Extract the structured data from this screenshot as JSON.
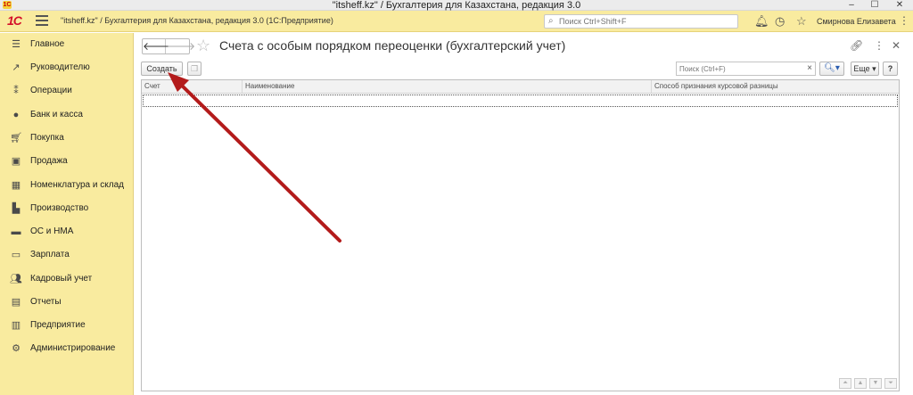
{
  "window": {
    "title": "\"itsheff.kz\" / Бухгалтерия для Казахстана, редакция 3.0",
    "minimize": "–",
    "maximize": "☐",
    "close": "✕"
  },
  "top_panel": {
    "logo": "1С",
    "caption": "\"itsheff.kz\" / Бухгалтерия для Казахстана, редакция 3.0  (1С:Предприятие)",
    "search_placeholder": "Поиск Ctrl+Shift+F",
    "user": "Смирнова Елизавета",
    "icons": [
      "bell-icon",
      "history-icon",
      "star-icon",
      "more-icon"
    ]
  },
  "sidebar": {
    "items": [
      {
        "label": "Главное",
        "icon": "menu-icon"
      },
      {
        "label": "Руководителю",
        "icon": "trend-icon"
      },
      {
        "label": "Операции",
        "icon": "operations-icon"
      },
      {
        "label": "Банк и касса",
        "icon": "bank-icon"
      },
      {
        "label": "Покупка",
        "icon": "cart-icon"
      },
      {
        "label": "Продажа",
        "icon": "bag-icon"
      },
      {
        "label": "Номенклатура и склад",
        "icon": "warehouse-icon"
      },
      {
        "label": "Производство",
        "icon": "factory-icon"
      },
      {
        "label": "ОС и НМА",
        "icon": "truck-icon"
      },
      {
        "label": "Зарплата",
        "icon": "salary-icon"
      },
      {
        "label": "Кадровый учет",
        "icon": "people-icon"
      },
      {
        "label": "Отчеты",
        "icon": "report-icon"
      },
      {
        "label": "Предприятие",
        "icon": "enterprise-icon"
      },
      {
        "label": "Администрирование",
        "icon": "gear-icon"
      }
    ]
  },
  "form": {
    "title": "Счета с особым порядком переоценки (бухгалтерский учет)",
    "back": "🡐",
    "forward": "🡒",
    "create_label": "Создать",
    "search_placeholder": "Поиск (Ctrl+F)",
    "more_label": "Еще ▾",
    "help_label": "?",
    "columns": [
      "Счет",
      "Наименование",
      "Способ признания курсовой разницы"
    ],
    "rows": []
  },
  "colors": {
    "panel": "#f9eb9f",
    "annotation_arrow": "#b31b1b"
  }
}
